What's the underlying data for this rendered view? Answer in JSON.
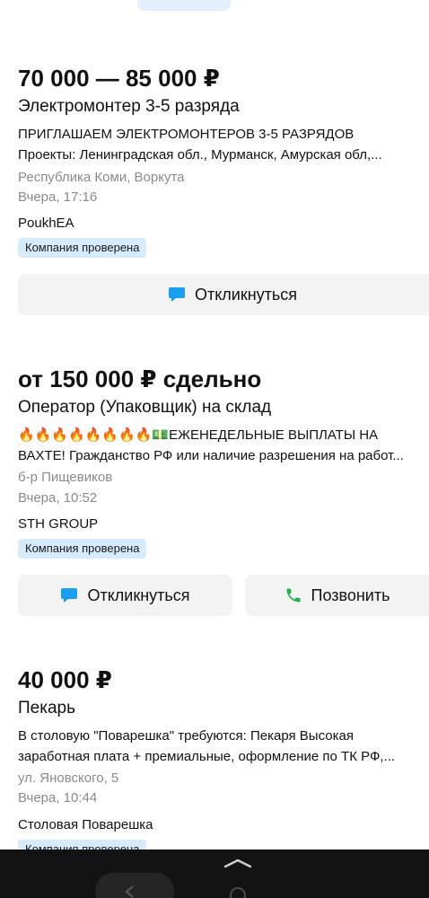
{
  "vacancies": [
    {
      "salary": "70 000 — 85 000 ₽",
      "title": "Электромонтер 3-5 разряда",
      "desc_line1": "ПРИГЛАШАЕМ ЭЛЕКТРОМОНТЕРОВ 3-5 РАЗРЯДОВ",
      "desc_line2": "Проекты: Ленинградская обл., Мурманск, Амурская обл,...",
      "location": "Республика Коми, Воркута",
      "date": "Вчера, 17:16",
      "company": "PoukhEA",
      "badge": "Компания проверена",
      "respond_label": "Откликнуться"
    },
    {
      "salary": "от 150 000 ₽ сдельно",
      "title": "Оператор (Упаковщик) на склад",
      "desc_emojis": "🔥🔥🔥🔥🔥🔥🔥🔥",
      "desc_money": "💵",
      "desc_line1_text": "ЕЖЕНЕДЕЛЬНЫЕ ВЫПЛАТЫ НА",
      "desc_line2": "ВАХТЕ! Гражданство РФ или наличие разрешения на работ...",
      "location": "б-р Пищевиков",
      "date": "Вчера, 10:52",
      "company": "STH GROUP",
      "badge": "Компания проверена",
      "respond_label": "Откликнуться",
      "call_label": "Позвонить"
    },
    {
      "salary": "40 000 ₽",
      "title": "Пекарь",
      "desc_line1": "В столовую \"Поварешка\" требуются: Пекаря Высокая",
      "desc_line2": "заработная плата + премиальные, оформление по ТК РФ,...",
      "location": "ул. Яновского, 5",
      "date": "Вчера, 10:44",
      "company": "Столовая Поварешка",
      "badge": "Компания проверена"
    }
  ],
  "colors": {
    "accent_blue": "#1a9ff0",
    "call_green": "#26b04a",
    "badge_bg": "#d6ecfd",
    "meta_gray": "#8b8b8b"
  }
}
